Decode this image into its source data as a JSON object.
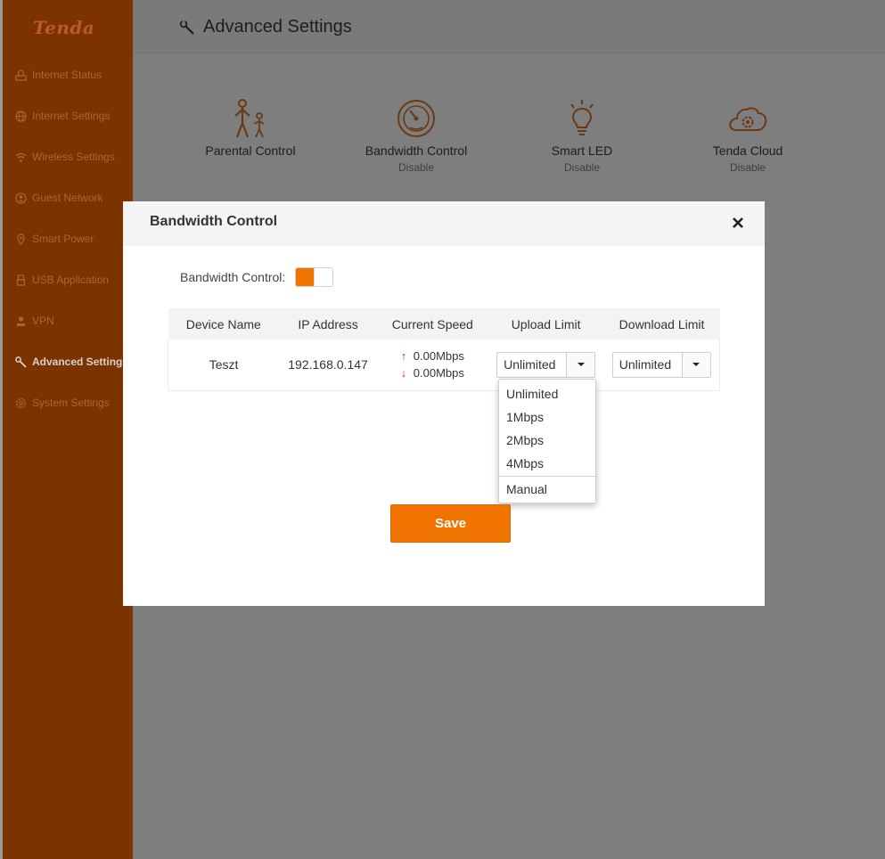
{
  "brand": {
    "logo_text": "Tenda"
  },
  "sidebar": {
    "items": [
      {
        "label": "Internet Status",
        "icon": "globe-computer-icon"
      },
      {
        "label": "Internet Settings",
        "icon": "globe-icon"
      },
      {
        "label": "Wireless Settings",
        "icon": "wifi-icon"
      },
      {
        "label": "Guest Network",
        "icon": "guest-icon"
      },
      {
        "label": "Smart Power",
        "icon": "power-icon"
      },
      {
        "label": "USB Application",
        "icon": "usb-icon"
      },
      {
        "label": "VPN",
        "icon": "vpn-icon"
      },
      {
        "label": "Advanced Settings",
        "icon": "wrench-icon",
        "active": true
      },
      {
        "label": "System Settings",
        "icon": "gear-icon"
      }
    ]
  },
  "header": {
    "title": "Advanced Settings",
    "icon": "wrench-icon"
  },
  "cards": [
    {
      "label": "Parental Control",
      "status": "",
      "icon": "parent-child-icon"
    },
    {
      "label": "Bandwidth Control",
      "status": "Disable",
      "icon": "speedometer-icon"
    },
    {
      "label": "Smart LED",
      "status": "Disable",
      "icon": "light-bulb-icon"
    },
    {
      "label": "Tenda Cloud",
      "status": "Disable",
      "icon": "cloud-gear-icon"
    }
  ],
  "modal": {
    "title": "Bandwidth Control",
    "toggle_label": "Bandwidth Control:",
    "toggle_on": true,
    "columns": [
      "Device Name",
      "IP Address",
      "Current Speed",
      "Upload Limit",
      "Download Limit"
    ],
    "rows": [
      {
        "device": "Teszt",
        "ip": "192.168.0.147",
        "upload_speed": "0.00Mbps",
        "download_speed": "0.00Mbps",
        "upload_limit": "Unlimited",
        "download_limit": "Unlimited"
      }
    ],
    "dropdown_options": [
      "Unlimited",
      "1Mbps",
      "2Mbps",
      "4Mbps",
      "Manual"
    ],
    "save_label": "Save"
  },
  "colors": {
    "accent": "#f07300",
    "sidebar_bg": "#7b3400",
    "overlay": "#7e7e7e"
  }
}
